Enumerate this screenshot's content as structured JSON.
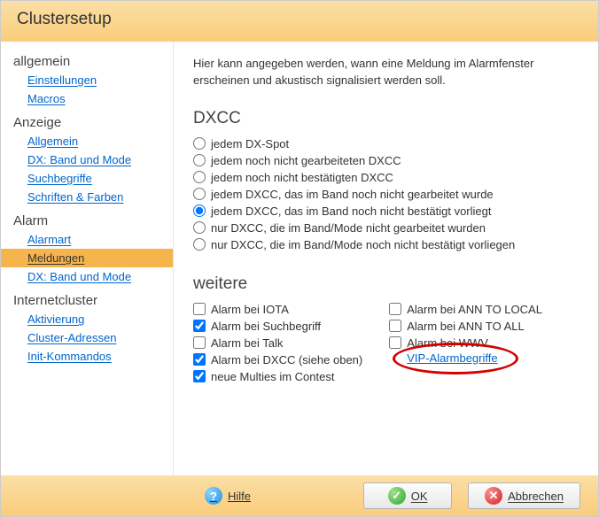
{
  "window_title": "Clustersetup",
  "sidebar": {
    "groups": [
      {
        "label": "allgemein",
        "items": [
          {
            "label": "Einstellungen"
          },
          {
            "label": "Macros"
          }
        ]
      },
      {
        "label": "Anzeige",
        "items": [
          {
            "label": "Allgemein"
          },
          {
            "label": "DX: Band und Mode"
          },
          {
            "label": "Suchbegriffe"
          },
          {
            "label": "Schriften & Farben"
          }
        ]
      },
      {
        "label": "Alarm",
        "items": [
          {
            "label": "Alarmart"
          },
          {
            "label": "Meldungen",
            "active": true
          },
          {
            "label": "DX: Band und Mode"
          }
        ]
      },
      {
        "label": "Internetcluster",
        "items": [
          {
            "label": "Aktivierung"
          },
          {
            "label": "Cluster-Adressen"
          },
          {
            "label": "Init-Kommandos"
          }
        ]
      }
    ]
  },
  "intro": "Hier kann angegeben werden,  wann eine Meldung im Alarmfenster erscheinen und akustisch signalisiert werden soll.",
  "dxcc": {
    "title": "DXCC",
    "options": [
      {
        "label": "jedem DX-Spot",
        "checked": false
      },
      {
        "label": "jedem noch nicht gearbeiteten DXCC",
        "checked": false
      },
      {
        "label": "jedem noch nicht bestätigten DXCC",
        "checked": false
      },
      {
        "label": "jedem DXCC, das im Band noch nicht gearbeitet wurde",
        "checked": false
      },
      {
        "label": "jedem DXCC, das im Band noch nicht bestätigt vorliegt",
        "checked": true
      },
      {
        "label": "nur DXCC, die im Band/Mode nicht gearbeitet wurden",
        "checked": false
      },
      {
        "label": "nur DXCC, die im Band/Mode noch nicht bestätigt vorliegen",
        "checked": false
      }
    ]
  },
  "weitere": {
    "title": "weitere",
    "left": [
      {
        "label": "Alarm bei IOTA",
        "checked": false
      },
      {
        "label": "Alarm bei Suchbegriff",
        "checked": true
      },
      {
        "label": "Alarm bei Talk",
        "checked": false
      },
      {
        "label": "Alarm bei DXCC (siehe oben)",
        "checked": true
      },
      {
        "label": "neue Multies im Contest",
        "checked": true
      }
    ],
    "right": [
      {
        "label": "Alarm bei ANN TO LOCAL",
        "checked": false
      },
      {
        "label": "Alarm bei ANN TO ALL",
        "checked": false
      },
      {
        "label": "Alarm bei WWV",
        "checked": false
      }
    ],
    "vip_link": "VIP-Alarmbegriffe"
  },
  "footer": {
    "help": "Hilfe",
    "ok": "OK",
    "cancel": "Abbrechen"
  }
}
